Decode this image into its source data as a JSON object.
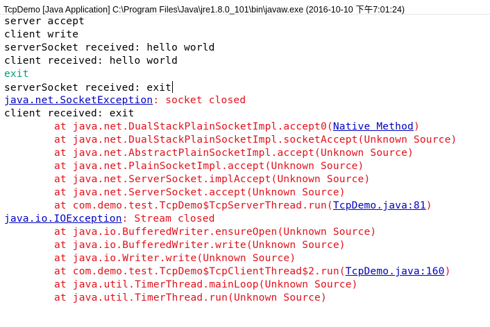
{
  "window": {
    "title": "TcpDemo [Java Application] C:\\Program Files\\Java\\jre1.8.0_101\\bin\\javaw.exe (2016-10-10 下午7:01:24)"
  },
  "colors": {
    "stdout": "#000000",
    "stderr": "#e0101a",
    "stdin": "#00a07a",
    "link": "#0000c0"
  },
  "console": {
    "lines": [
      {
        "type": "stdout",
        "indent": false,
        "segments": [
          {
            "text": "server accept"
          }
        ]
      },
      {
        "type": "stdout",
        "indent": false,
        "segments": [
          {
            "text": "client write"
          }
        ]
      },
      {
        "type": "stdout",
        "indent": false,
        "segments": [
          {
            "text": "serverSocket received: hello world"
          }
        ]
      },
      {
        "type": "stdout",
        "indent": false,
        "segments": [
          {
            "text": "client received: hello world"
          }
        ]
      },
      {
        "type": "stdin",
        "indent": false,
        "segments": [
          {
            "text": "exit"
          }
        ]
      },
      {
        "type": "stdout",
        "indent": false,
        "caret": true,
        "segments": [
          {
            "text": "serverSocket received: exit"
          }
        ]
      },
      {
        "type": "stderr",
        "indent": false,
        "segments": [
          {
            "text": "java.net.SocketException",
            "link": true
          },
          {
            "text": ": socket closed"
          }
        ]
      },
      {
        "type": "stdout",
        "indent": false,
        "segments": [
          {
            "text": "client received: exit"
          }
        ]
      },
      {
        "type": "stderr",
        "indent": true,
        "segments": [
          {
            "text": "at java.net.DualStackPlainSocketImpl.accept0("
          },
          {
            "text": "Native Method",
            "link": true
          },
          {
            "text": ")"
          }
        ]
      },
      {
        "type": "stderr",
        "indent": true,
        "segments": [
          {
            "text": "at java.net.DualStackPlainSocketImpl.socketAccept(Unknown Source)"
          }
        ]
      },
      {
        "type": "stderr",
        "indent": true,
        "segments": [
          {
            "text": "at java.net.AbstractPlainSocketImpl.accept(Unknown Source)"
          }
        ]
      },
      {
        "type": "stderr",
        "indent": true,
        "segments": [
          {
            "text": "at java.net.PlainSocketImpl.accept(Unknown Source)"
          }
        ]
      },
      {
        "type": "stderr",
        "indent": true,
        "segments": [
          {
            "text": "at java.net.ServerSocket.implAccept(Unknown Source)"
          }
        ]
      },
      {
        "type": "stderr",
        "indent": true,
        "segments": [
          {
            "text": "at java.net.ServerSocket.accept(Unknown Source)"
          }
        ]
      },
      {
        "type": "stderr",
        "indent": true,
        "segments": [
          {
            "text": "at com.demo.test.TcpDemo$TcpServerThread.run("
          },
          {
            "text": "TcpDemo.java:81",
            "link": true
          },
          {
            "text": ")"
          }
        ]
      },
      {
        "type": "stderr",
        "indent": false,
        "segments": [
          {
            "text": "java.io.IOException",
            "link": true
          },
          {
            "text": ": Stream closed"
          }
        ]
      },
      {
        "type": "stderr",
        "indent": true,
        "segments": [
          {
            "text": "at java.io.BufferedWriter.ensureOpen(Unknown Source)"
          }
        ]
      },
      {
        "type": "stderr",
        "indent": true,
        "segments": [
          {
            "text": "at java.io.BufferedWriter.write(Unknown Source)"
          }
        ]
      },
      {
        "type": "stderr",
        "indent": true,
        "segments": [
          {
            "text": "at java.io.Writer.write(Unknown Source)"
          }
        ]
      },
      {
        "type": "stderr",
        "indent": true,
        "segments": [
          {
            "text": "at com.demo.test.TcpDemo$TcpClientThread$2.run("
          },
          {
            "text": "TcpDemo.java:160",
            "link": true
          },
          {
            "text": ")"
          }
        ]
      },
      {
        "type": "stderr",
        "indent": true,
        "segments": [
          {
            "text": "at java.util.TimerThread.mainLoop(Unknown Source)"
          }
        ]
      },
      {
        "type": "stderr",
        "indent": true,
        "segments": [
          {
            "text": "at java.util.TimerThread.run(Unknown Source)"
          }
        ]
      }
    ]
  }
}
